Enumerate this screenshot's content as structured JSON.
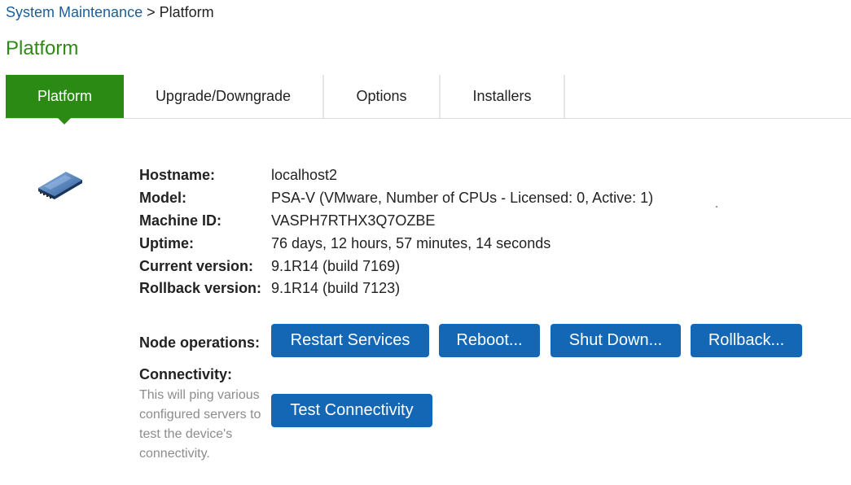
{
  "breadcrumb": {
    "parent": "System Maintenance",
    "separator": ">",
    "current": "Platform"
  },
  "page_title": "Platform",
  "tabs": [
    {
      "label": "Platform",
      "active": true
    },
    {
      "label": "Upgrade/Downgrade",
      "active": false
    },
    {
      "label": "Options",
      "active": false
    },
    {
      "label": "Installers",
      "active": false
    }
  ],
  "device_icon": "hard-drive-icon",
  "info": {
    "hostname": {
      "label": "Hostname:",
      "value": "localhost2"
    },
    "model": {
      "label": "Model:",
      "value": "PSA-V (VMware, Number of CPUs - Licensed: 0, Active: 1)"
    },
    "machine_id": {
      "label": "Machine ID:",
      "value": "VASPH7RTHX3Q7OZBE"
    },
    "uptime": {
      "label": "Uptime:",
      "value": "76 days, 12 hours, 57 minutes, 14 seconds"
    },
    "current_version": {
      "label": "Current version:",
      "value": "9.1R14 (build 7169)"
    },
    "rollback_version": {
      "label": "Rollback version:",
      "value": "9.1R14 (build 7123)"
    }
  },
  "node_operations": {
    "label": "Node operations:",
    "restart_services": "Restart Services",
    "reboot": "Reboot...",
    "shut_down": "Shut Down...",
    "rollback": "Rollback..."
  },
  "connectivity": {
    "label": "Connectivity:",
    "help": "This will ping various configured servers to test the device's connectivity.",
    "test_button": "Test Connectivity"
  },
  "colors": {
    "accent_green": "#2a8a14",
    "title_green": "#2e8a15",
    "button_blue": "#1467b5",
    "link_blue": "#1a5e9a"
  }
}
